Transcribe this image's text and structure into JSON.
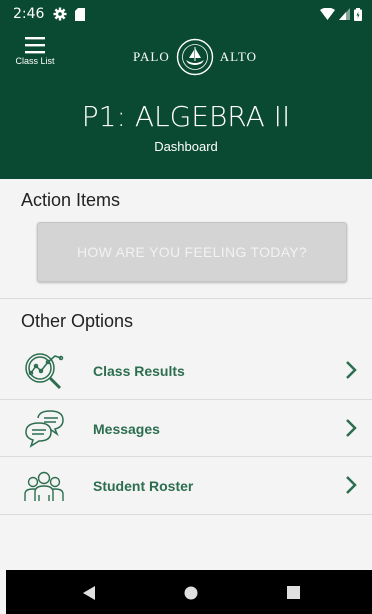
{
  "status_bar": {
    "time": "2:46",
    "icons": [
      "gear-icon",
      "sd-card-icon",
      "wifi-icon",
      "signal-icon",
      "battery-icon"
    ]
  },
  "header": {
    "menu_label": "Class List",
    "logo_left": "PALO",
    "logo_right": "ALTO",
    "title": "P1: ALGEBRA II",
    "subtitle": "Dashboard"
  },
  "action_items": {
    "title": "Action Items",
    "feeling_button": "HOW ARE YOU FEELING TODAY?"
  },
  "other_options": {
    "title": "Other Options",
    "items": [
      {
        "label": "Class Results",
        "icon": "chart-magnifier-icon"
      },
      {
        "label": "Messages",
        "icon": "chat-bubbles-icon"
      },
      {
        "label": "Student Roster",
        "icon": "people-icon"
      }
    ]
  },
  "colors": {
    "brand_green": "#0b4a32",
    "accent_green": "#2d6e50",
    "background": "#f4f4f4"
  },
  "nav": {
    "icons": [
      "back-icon",
      "home-icon",
      "recents-icon"
    ]
  }
}
